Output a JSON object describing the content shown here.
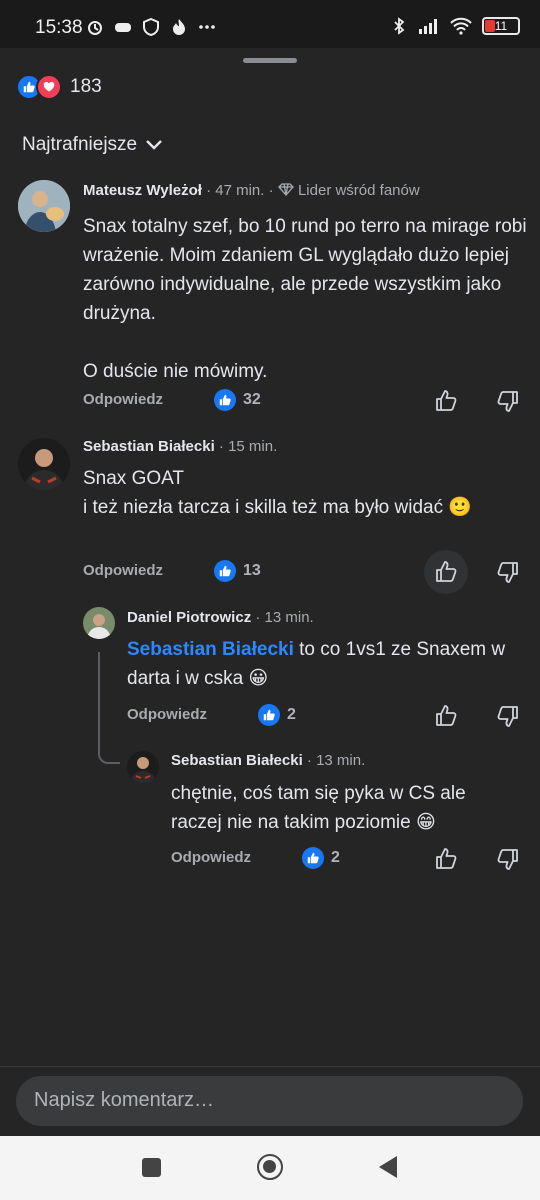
{
  "status": {
    "time": "15:38",
    "battery": "11"
  },
  "reactions": {
    "count": "183"
  },
  "sort": {
    "label": "Najtrafniejsze"
  },
  "comments": [
    {
      "author": "Mateusz Wyleżoł",
      "time": "· 47 min. ·",
      "badge": "Lider wśród fanów",
      "text": "Snax totalny szef, bo 10 rund po terro na mirage robi wrażenie. Moim zdaniem GL wyglądało dużo lepiej zarówno indywidualne, ale przede wszystkim jako drużyna.",
      "text2": "O duście nie mówimy.",
      "reply_label": "Odpowiedz",
      "likes": "32"
    },
    {
      "author": "Sebastian Białecki",
      "time": "· 15 min.",
      "text": "Snax GOAT",
      "text2": "i też niezła tarcza i skilla też ma było widać 🙂",
      "reply_label": "Odpowiedz",
      "likes": "13"
    },
    {
      "author": "Daniel Piotrowicz",
      "time": "· 13 min.",
      "mention": "Sebastian Białecki",
      "text": " to co 1vs1 ze Snaxem w darta i w cska 😀",
      "reply_label": "Odpowiedz",
      "likes": "2"
    },
    {
      "author": "Sebastian Białecki",
      "time": "· 13 min.",
      "text": "chętnie, coś tam się pyka w CS ale raczej nie na takim poziomie 😁",
      "reply_label": "Odpowiedz",
      "likes": "2"
    }
  ],
  "composer": {
    "placeholder": "Napisz komentarz…"
  }
}
